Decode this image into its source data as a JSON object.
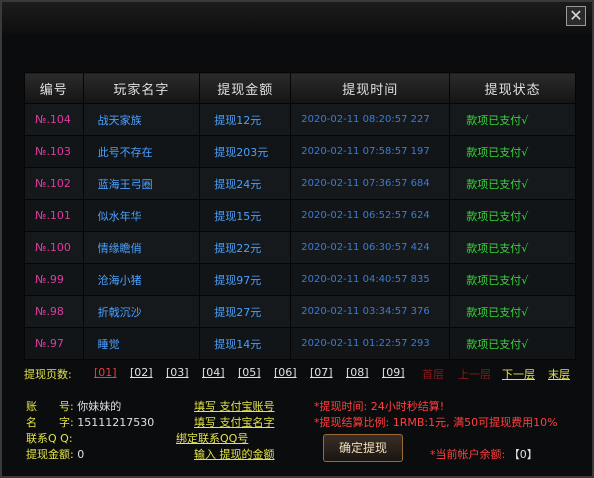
{
  "table": {
    "headers": [
      "编号",
      "玩家名字",
      "提现金额",
      "提现时间",
      "提现状态"
    ],
    "rows": [
      {
        "id": "№.104",
        "name": "战天家族",
        "amount": "提现12元",
        "time": "2020-02-11 08:20:57 227",
        "status": "款项已支付√"
      },
      {
        "id": "№.103",
        "name": "此号不存在",
        "amount": "提现203元",
        "time": "2020-02-11 07:58:57 197",
        "status": "款项已支付√"
      },
      {
        "id": "№.102",
        "name": "蓝海王弓圈",
        "amount": "提现24元",
        "time": "2020-02-11 07:36:57 684",
        "status": "款项已支付√"
      },
      {
        "id": "№.101",
        "name": "似水年华",
        "amount": "提现15元",
        "time": "2020-02-11 06:52:57 624",
        "status": "款项已支付√"
      },
      {
        "id": "№.100",
        "name": "情缘瞻俏",
        "amount": "提现22元",
        "time": "2020-02-11 06:30:57 424",
        "status": "款项已支付√"
      },
      {
        "id": "№.99",
        "name": "沧海小猪",
        "amount": "提现97元",
        "time": "2020-02-11 04:40:57 835",
        "status": "款项已支付√"
      },
      {
        "id": "№.98",
        "name": "折戟沉沙",
        "amount": "提现27元",
        "time": "2020-02-11 03:34:57 376",
        "status": "款项已支付√"
      },
      {
        "id": "№.97",
        "name": "睡觉",
        "amount": "提现14元",
        "time": "2020-02-11 01:22:57 293",
        "status": "款项已支付√"
      }
    ]
  },
  "pager": {
    "label": "提现页数:",
    "pages": [
      "[01]",
      "[02]",
      "[03]",
      "[04]",
      "[05]",
      "[06]",
      "[07]",
      "[08]",
      "[09]"
    ],
    "first": "首层",
    "prev": "上一层",
    "next": "下一层",
    "last": "末层"
  },
  "account": {
    "account_label": "账　　号:",
    "account_value": "你妹妹的",
    "name_label": "名　　字:",
    "name_value": "15111217530",
    "qq_label": "联系Q Q:",
    "amount_label": "提现金额:",
    "amount_value": "0"
  },
  "links": {
    "fill_account": "填写 支付宝账号",
    "fill_name": "填写 支付宝名字",
    "bind_qq": "绑定联系QQ号",
    "input_amount": "输入 提现的金额"
  },
  "notes": {
    "time_note": "*提现时间: 24小时秒结算!",
    "ratio_note": "*提现结算比例: 1RMB:1元, 满50可提现费用10%",
    "balance_label": "*当前帐户余额:",
    "balance_value": "【0】"
  },
  "confirm_label": "确定提现",
  "close_label": "✕"
}
